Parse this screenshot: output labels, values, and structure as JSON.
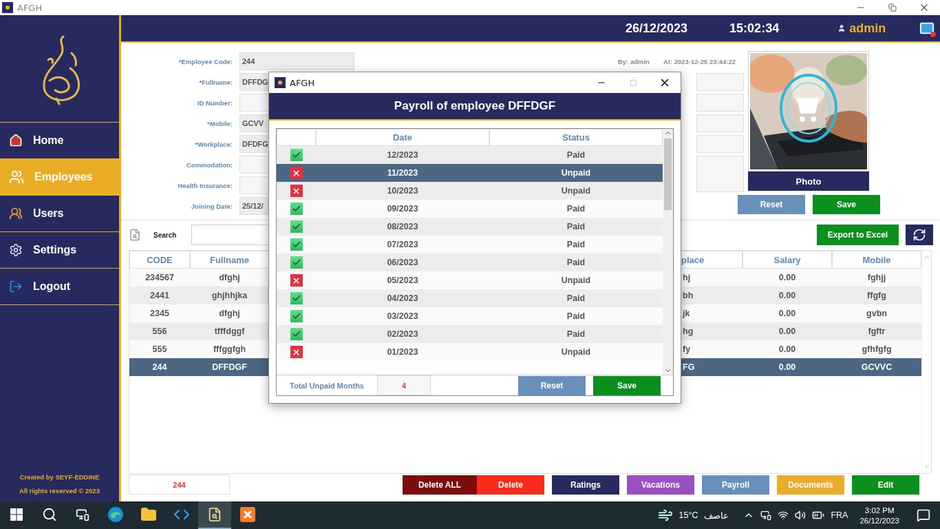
{
  "window": {
    "title": "AFGH"
  },
  "sidebar": {
    "items": [
      {
        "label": "Home",
        "kind": "home",
        "selected": false
      },
      {
        "label": "Employees",
        "kind": "employees",
        "selected": true
      },
      {
        "label": "Users",
        "kind": "users",
        "selected": false
      },
      {
        "label": "Settings",
        "kind": "settings",
        "selected": false
      },
      {
        "label": "Logout",
        "kind": "logout",
        "selected": false
      }
    ],
    "footer": [
      "Created by SEYF-EDDINE",
      "All rights reserved © 2023"
    ]
  },
  "header": {
    "date": "26/12/2023",
    "time": "15:02:34",
    "user": "admin"
  },
  "form": {
    "fields": [
      {
        "label": "*Employee Code:",
        "value": "244"
      },
      {
        "label": "*Fullname:",
        "value": "DFFDG"
      },
      {
        "label": "ID Number:"
      },
      {
        "label": "*Mobile:",
        "value": "GCVV"
      },
      {
        "label": "*Workplace:",
        "value": "DFDFG"
      },
      {
        "label": "Commodation:"
      },
      {
        "label": "Health Insurance:"
      },
      {
        "label": "Joining Date:",
        "value": "25/12/"
      }
    ],
    "created_by": "By: admin",
    "created_at": "At: 2023-12-25 23:44:22"
  },
  "photo": {
    "kind": "picture",
    "label": "Photo",
    "buttons": [
      "Reset",
      "Save"
    ]
  },
  "search": {
    "label": "Search"
  },
  "export_button": "Export to Excel",
  "table": {
    "columns": [
      "CODE",
      "Fullname",
      "place",
      "Salary",
      "Mobile"
    ],
    "rows": [
      {
        "cells": [
          "234567",
          "dfghj",
          "hj",
          "0.00",
          "fghjj"
        ],
        "selected": false
      },
      {
        "cells": [
          "2441",
          "ghjhhjka",
          "bh",
          "0.00",
          "ffgfg"
        ],
        "selected": false
      },
      {
        "cells": [
          "2345",
          "dfghj",
          "jk",
          "0.00",
          "gvbn"
        ],
        "selected": false
      },
      {
        "cells": [
          "556",
          "tfffdggf",
          "hg",
          "0.00",
          "fgftr"
        ],
        "selected": false
      },
      {
        "cells": [
          "555",
          "fffggfgh",
          "fy",
          "0.00",
          "gfhfgfg"
        ],
        "selected": false
      },
      {
        "cells": [
          "244",
          "DFFDGF",
          "FG",
          "0.00",
          "GCVVC"
        ],
        "selected": true
      }
    ]
  },
  "bottom_bar": {
    "count": "244",
    "buttons": [
      {
        "label": "Delete ALL",
        "color": "#7b0d0d"
      },
      {
        "label": "Delete",
        "color": "#fb2b1c"
      },
      {
        "label": "Ratings",
        "color": "#262a5e"
      },
      {
        "label": "Vacations",
        "color": "#9b4fc2"
      },
      {
        "label": "Payroll",
        "color": "#6890ba"
      },
      {
        "label": "Documents",
        "color": "#e9ad2a"
      },
      {
        "label": "Edit",
        "color": "#0c8f1c"
      }
    ]
  },
  "dialog": {
    "title": "AFGH",
    "heading": "Payroll of employee DFFDGF",
    "columns": [
      "Date",
      "Status"
    ],
    "rows": [
      {
        "paid": true,
        "date": "12/2023",
        "status": "Paid",
        "selected": false
      },
      {
        "paid": false,
        "date": "11/2023",
        "status": "Unpaid",
        "selected": true
      },
      {
        "paid": false,
        "date": "10/2023",
        "status": "Unpaid",
        "selected": false
      },
      {
        "paid": true,
        "date": "09/2023",
        "status": "Paid",
        "selected": false
      },
      {
        "paid": true,
        "date": "08/2023",
        "status": "Paid",
        "selected": false
      },
      {
        "paid": true,
        "date": "07/2023",
        "status": "Paid",
        "selected": false
      },
      {
        "paid": true,
        "date": "06/2023",
        "status": "Paid",
        "selected": false
      },
      {
        "paid": false,
        "date": "05/2023",
        "status": "Unpaid",
        "selected": false
      },
      {
        "paid": true,
        "date": "04/2023",
        "status": "Paid",
        "selected": false
      },
      {
        "paid": true,
        "date": "03/2023",
        "status": "Paid",
        "selected": false
      },
      {
        "paid": true,
        "date": "02/2023",
        "status": "Paid",
        "selected": false
      },
      {
        "paid": false,
        "date": "01/2023",
        "status": "Unpaid",
        "selected": false
      }
    ],
    "total_label": "Total Unpaid Months",
    "total": "4",
    "buttons": [
      "Reset",
      "Save"
    ]
  },
  "taskbar": {
    "apps": [
      {
        "kind": "windows",
        "selected": false
      },
      {
        "kind": "search",
        "selected": false
      },
      {
        "kind": "taskview",
        "selected": false
      },
      {
        "kind": "edge",
        "selected": false
      },
      {
        "kind": "folder",
        "selected": false
      },
      {
        "kind": "vscode",
        "selected": false
      },
      {
        "kind": "python",
        "selected": true
      },
      {
        "kind": "xampp",
        "selected": false
      }
    ],
    "temperature": "15°C",
    "weather": "عاصف",
    "language": "FRA",
    "time": "3:02 PM",
    "date": "26/12/2023"
  }
}
